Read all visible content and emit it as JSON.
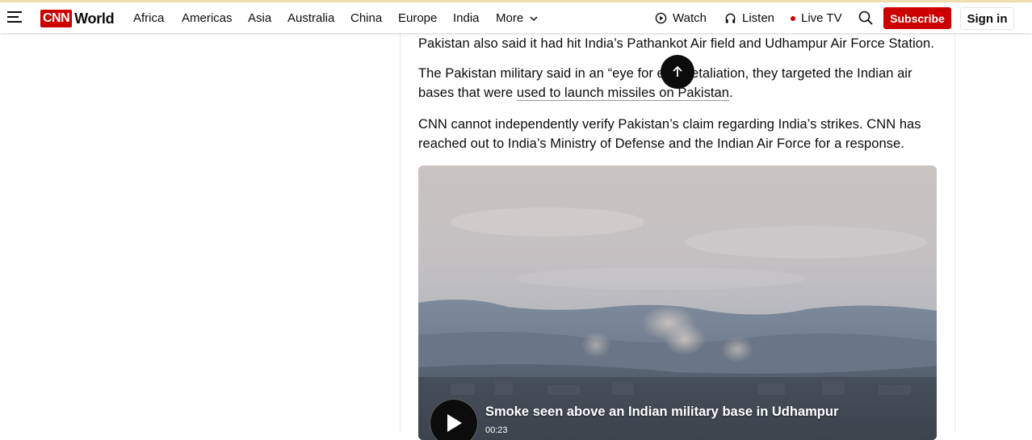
{
  "nav": {
    "brand_badge": "CNN",
    "section": "World",
    "items": [
      "Africa",
      "Americas",
      "Asia",
      "Australia",
      "China",
      "Europe",
      "India",
      "More"
    ],
    "watch": "Watch",
    "listen": "Listen",
    "live_tv": "Live TV",
    "subscribe": "Subscribe",
    "sign_in": "Sign in"
  },
  "article": {
    "p1": "Pakistan also said it had hit India’s Pathankot Air field and Udhampur Air Force Station.",
    "p2_before": "The Pakistan military said in an “eye for eye” ",
    "p2_hidden": "retaliation",
    "p2_after": ", they targeted the Indian air bases that were ",
    "p2_link": "used to launch missiles on Pakistan",
    "p2_end": ".",
    "p3": "CNN cannot independently verify Pakistan’s claim regarding India’s strikes. CNN has reached out to India’s Ministry of Defense and the Indian Air Force for a response."
  },
  "video": {
    "title": "Smoke seen above an Indian military base in Udhampur",
    "duration": "00:23"
  },
  "colors": {
    "brand_red": "#cc0000",
    "text": "#0c0c0c",
    "top_strip": "#f2dfb0"
  },
  "icons": {
    "menu": "hamburger-icon",
    "watch": "play-circle-icon",
    "listen": "headphones-icon",
    "live": "live-dot-icon",
    "search": "search-icon",
    "more": "chevron-down-icon",
    "scroll_top": "arrow-up-icon",
    "video_play": "play-icon"
  }
}
